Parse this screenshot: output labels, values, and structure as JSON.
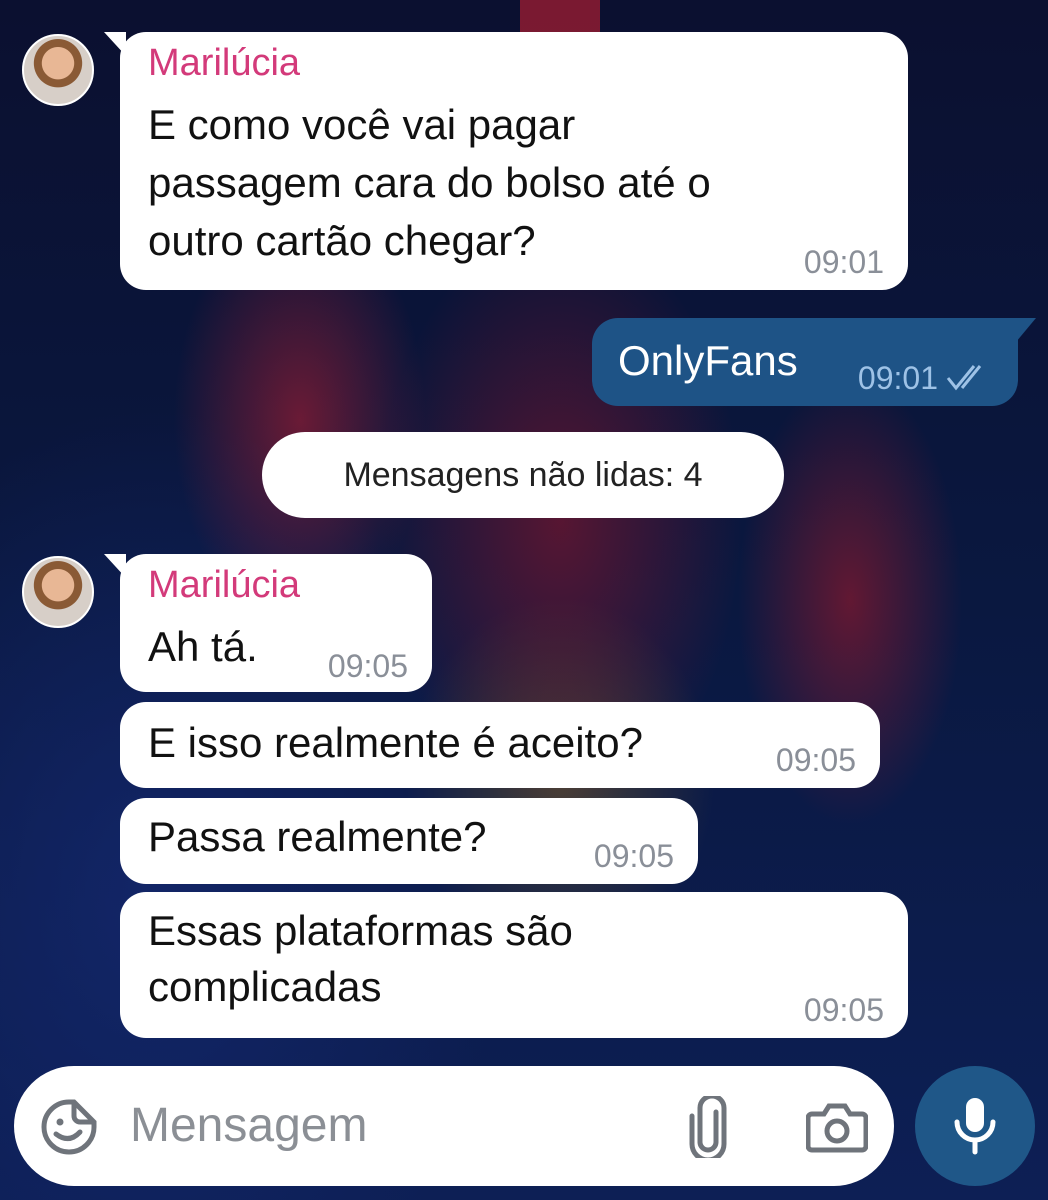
{
  "messages": [
    {
      "sender": "Marilúcia",
      "lines": [
        "E como você vai pagar",
        "passagem cara do bolso até o",
        "outro cartão chegar?"
      ],
      "time": "09:01"
    },
    {
      "outgoing": true,
      "text": "OnlyFans",
      "time": "09:01",
      "status": "read-double-check"
    },
    {
      "sender": "Marilúcia",
      "text": "Ah tá.",
      "time": "09:05"
    },
    {
      "text": "E isso realmente é aceito?",
      "time": "09:05"
    },
    {
      "text": "Passa realmente?",
      "time": "09:05"
    },
    {
      "lines": [
        "Essas plataformas são",
        "complicadas"
      ],
      "time": "09:05"
    }
  ],
  "unread_divider": "Mensagens não lidas: 4",
  "composer": {
    "placeholder": "Mensagem",
    "icons": [
      "sticker-icon",
      "paperclip-icon",
      "camera-icon",
      "microphone-icon"
    ]
  },
  "colors": {
    "sender_name": "#d33a7a",
    "outgoing_bubble": "#1e5386",
    "send_button": "#1f5788",
    "incoming_bubble": "#ffffff"
  }
}
